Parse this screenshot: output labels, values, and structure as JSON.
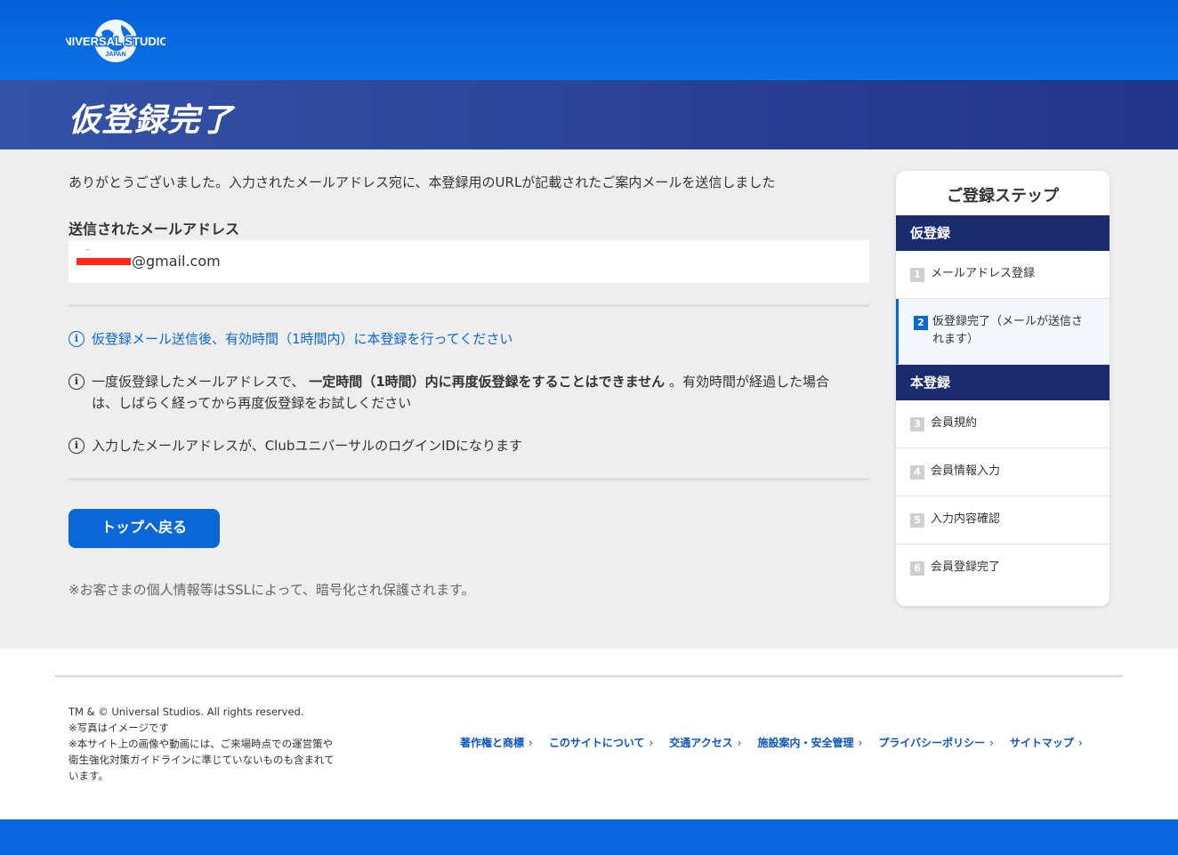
{
  "colors": {
    "primary": "#0b66d6",
    "header": "#0a6be4",
    "title_band": "#2a3f95",
    "sidebar_head": "#1b2c6e"
  },
  "header": {
    "logo_line1": "UNIVERSAL STUDIOS",
    "logo_line2": "JAPAN"
  },
  "page": {
    "title": "仮登録完了"
  },
  "main": {
    "thanks_message": "ありがとうございました。入力されたメールアドレス宛に、本登録用のURLが記載されたご案内メールを送信しました",
    "email_label": "送信されたメールアドレス",
    "email_value": "@gmail.com",
    "notices": [
      {
        "text": "仮登録メール送信後、有効時間（1時間内）に本登録を行ってください"
      },
      {
        "text_before": "一度仮登録したメールアドレスで、",
        "text_bold": "一定時間（1時間）内に再度仮登録をすることはできません",
        "text_after_line1": "。有効時間が経過した場合",
        "text_line2": "は、しばらく経ってから再度仮登録をお試しください"
      },
      {
        "text": "入力したメールアドレスが、ClubユニバーサルのログインIDになります"
      }
    ],
    "back_button": "トップへ戻る",
    "ssl_note": "※お客さまの個人情報等はSSLによって、暗号化され保護されます。"
  },
  "steps": {
    "title": "ご登録ステップ",
    "section1": "仮登録",
    "section2": "本登録",
    "items": [
      {
        "num": "1",
        "label": "メールアドレス登録"
      },
      {
        "num": "2",
        "label_line1": "仮登録完了（メールが送信さ",
        "label_line2": "れます）"
      },
      {
        "num": "3",
        "label": "会員規約"
      },
      {
        "num": "4",
        "label": "会員情報入力"
      },
      {
        "num": "5",
        "label": "入力内容確認"
      },
      {
        "num": "6",
        "label": "会員登録完了"
      }
    ]
  },
  "footer": {
    "copyright": "TM & © Universal Studios. All rights reserved.",
    "note1": "※写真はイメージです",
    "note2": "※本サイト上の画像や動画には、ご来場時点での運営策や衛生強化対策ガイドラインに準じていないものも含まれています。",
    "links": [
      "著作権と商標",
      "このサイトについて",
      "交通アクセス",
      "施設案内・安全管理",
      "プライバシーポリシー",
      "サイトマップ"
    ]
  }
}
